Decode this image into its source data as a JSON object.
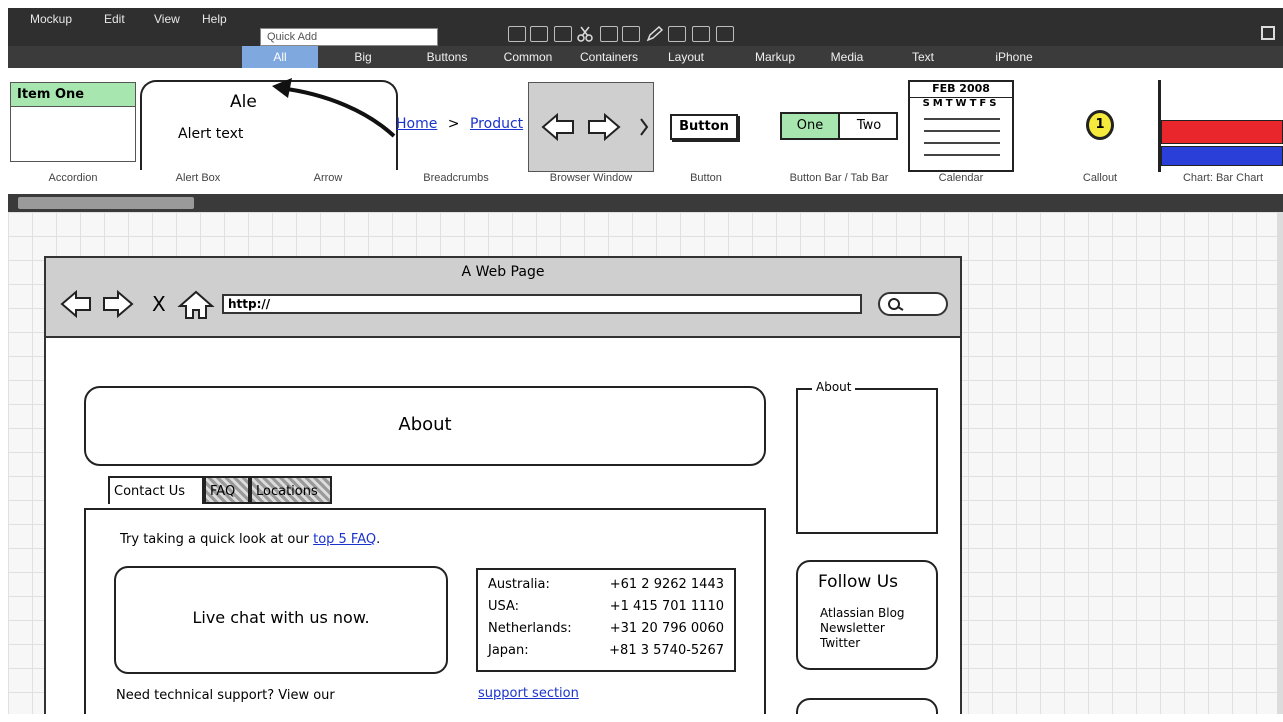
{
  "menubar": {
    "items": [
      "Mockup",
      "Edit",
      "View",
      "Help"
    ],
    "quick_add_placeholder": "Quick Add"
  },
  "categories": [
    "All",
    "Big",
    "Buttons",
    "Common",
    "Containers",
    "Layout",
    "Markup",
    "Media",
    "Text",
    "iPhone"
  ],
  "palette": {
    "accordion": {
      "label": "Accordion",
      "item": "Item One"
    },
    "alert_box": {
      "label": "Alert Box",
      "title": "Ale",
      "text": "Alert text"
    },
    "arrow": {
      "label": "Arrow"
    },
    "breadcrumbs": {
      "label": "Breadcrumbs",
      "home": "Home",
      "sep": ">",
      "product": "Product"
    },
    "browser_window": {
      "label": "Browser Window"
    },
    "button": {
      "label": "Button",
      "text": "Button"
    },
    "button_bar": {
      "label": "Button Bar / Tab Bar",
      "one": "One",
      "two": "Two"
    },
    "calendar": {
      "label": "Calendar",
      "month": "FEB 2008",
      "days": "SMTWTFS"
    },
    "callout": {
      "label": "Callout",
      "number": "1"
    },
    "chart": {
      "label": "Chart: Bar Chart"
    }
  },
  "mockup": {
    "window_title": "A Web Page",
    "url": "http://",
    "nav_close": "X",
    "about_heading": "About",
    "tabs": [
      "Contact Us",
      "FAQ",
      "Locations"
    ],
    "faq_prefix": "Try taking a quick look at our ",
    "faq_link": "top 5 FAQ",
    "faq_suffix": ".",
    "live_chat": "Live chat with us now.",
    "phones": [
      {
        "country": "Australia:",
        "number": "+61 2 9262 1443"
      },
      {
        "country": "USA:",
        "number": "+1 415 701 1110"
      },
      {
        "country": "Netherlands:",
        "number": "+31 20 796 0060"
      },
      {
        "country": "Japan:",
        "number": "+81 3 5740-5267"
      }
    ],
    "support_text": "Need technical support? View our",
    "support_link": "support section",
    "about_group": "About",
    "follow_title": "Follow Us",
    "follow_links": [
      "Atlassian Blog",
      "Newsletter",
      "Twitter"
    ]
  }
}
